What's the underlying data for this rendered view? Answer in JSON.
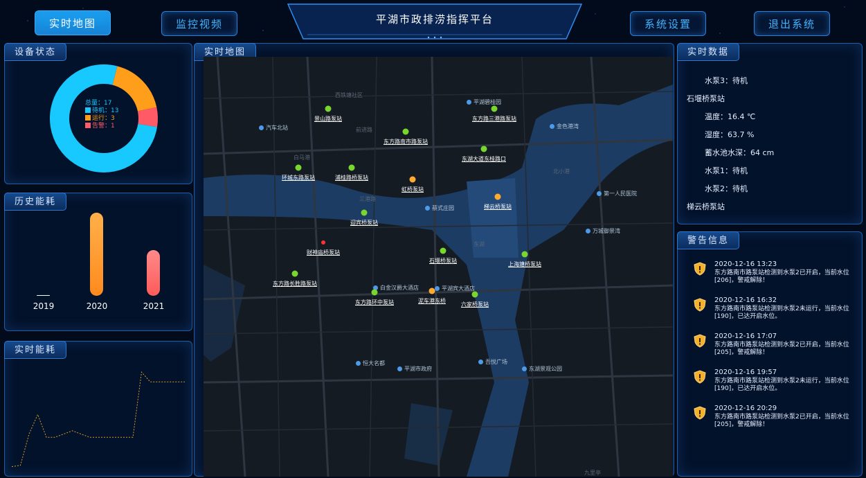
{
  "nav": {
    "realtime_map": "实时地图",
    "monitor_video": "监控视频",
    "title": "平湖市政排涝指挥平台",
    "system_settings": "系统设置",
    "exit_system": "退出系统"
  },
  "panels": {
    "device_status": "设备状态",
    "history_energy": "历史能耗",
    "realtime_energy": "实时能耗",
    "realtime_map": "实时地图",
    "realtime_data": "实时数据",
    "alert_info": "警告信息"
  },
  "device_status": {
    "total_label": "总量：17",
    "legend": [
      {
        "label": "待机：13",
        "value": 13,
        "color": "#18c9ff"
      },
      {
        "label": "运行：3",
        "value": 3,
        "color": "#ff9e1a"
      },
      {
        "label": "告警：1",
        "value": 1,
        "color": "#ff5a66"
      }
    ]
  },
  "chart_data": [
    {
      "type": "pie",
      "title": "",
      "categories": [
        "待机",
        "运行",
        "告警"
      ],
      "values": [
        13,
        3,
        1
      ],
      "colors": [
        "#18c9ff",
        "#ff9e1a",
        "#ff5a66"
      ]
    },
    {
      "type": "bar",
      "title": "",
      "categories": [
        "2019",
        "2020",
        "2021"
      ],
      "values": [
        0.1,
        100,
        55
      ],
      "colors": [
        "#ffffff",
        "#ff9e3a",
        "#ff6a6a"
      ]
    },
    {
      "type": "line",
      "title": "",
      "x": [
        0,
        1,
        2,
        3,
        4,
        5,
        6,
        7,
        8,
        9,
        10,
        11,
        12,
        13,
        14,
        15,
        16,
        17,
        18,
        19,
        20
      ],
      "values": [
        10,
        12,
        60,
        90,
        55,
        55,
        60,
        65,
        60,
        55,
        55,
        55,
        55,
        55,
        55,
        155,
        140,
        140,
        140,
        140,
        140
      ],
      "color": "#d89b2a"
    }
  ],
  "history_energy": {
    "years": [
      "2019",
      "2020",
      "2021"
    ]
  },
  "map": {
    "stations": [
      {
        "name": "景山路泵站",
        "status": "green"
      },
      {
        "name": "东方路南市路泵站",
        "status": "green"
      },
      {
        "name": "东方路三港路泵站",
        "status": "green"
      },
      {
        "name": "东湖大道东桂路口",
        "status": "green"
      },
      {
        "name": "环城东路泵站",
        "status": "green"
      },
      {
        "name": "浦桂路桥泵站",
        "status": "green"
      },
      {
        "name": "虹桥泵站",
        "status": "orange"
      },
      {
        "name": "梯云桥泵站",
        "status": "orange"
      },
      {
        "name": "迎宾桥泵站",
        "status": "green"
      },
      {
        "name": "财神庙桥泵站",
        "status": "red"
      },
      {
        "name": "石堰桥泵站",
        "status": "green"
      },
      {
        "name": "上海塘桥泵站",
        "status": "green"
      },
      {
        "name": "东方路长胜路泵站",
        "status": "green"
      },
      {
        "name": "东方路环中泵站",
        "status": "green"
      },
      {
        "name": "泥车港东桥",
        "status": "orange"
      },
      {
        "name": "六家桥泵站",
        "status": "green"
      }
    ],
    "pois": [
      "平湖碧桂园",
      "金色港湾",
      "汽车北站",
      "蔡式庄园",
      "第一人民医院",
      "万城御景湾",
      "白金汉爵大酒店",
      "平湖宾大酒店",
      "恒大名都",
      "平湖市政府",
      "吾悦广场",
      "东湖景观公园"
    ],
    "roads": [
      "西铁塘社区",
      "前进路",
      "北小港",
      "白马港",
      "三港路",
      "东湖",
      "九里亭"
    ]
  },
  "realtime_data": {
    "lines": [
      "水泵3：待机",
      "石堰桥泵站",
      "温度：16.4 ℃",
      "湿度：63.7 %",
      "蓄水池水深：64 cm",
      "水泵1：待机",
      "水泵2：待机",
      "梯云桥泵站"
    ]
  },
  "alerts": [
    {
      "time": "2020-12-16 13:23",
      "message": "东方路南市路泵站检测到水泵2已开启，当前水位[206]，警戒解除！"
    },
    {
      "time": "2020-12-16 16:32",
      "message": "东方路南市路泵站检测到水泵2未运行，当前水位[190]，已达开启水位。"
    },
    {
      "time": "2020-12-16 17:07",
      "message": "东方路南市路泵站检测到水泵2已开启，当前水位[205]，警戒解除！"
    },
    {
      "time": "2020-12-16 19:57",
      "message": "东方路南市路泵站检测到水泵2未运行，当前水位[190]，已达开启水位。"
    },
    {
      "time": "2020-12-16 20:29",
      "message": "东方路南市路泵站检测到水泵2已开启，当前水位[205]，警戒解除！"
    }
  ]
}
